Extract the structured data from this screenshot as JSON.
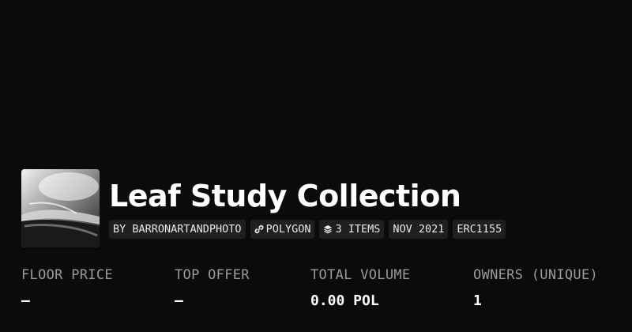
{
  "collection": {
    "title": "Leaf Study Collection",
    "thumbnail_icon": "leaf-photo-thumbnail"
  },
  "tags": {
    "creator": "BY BARRONARTANDPHOTO",
    "chain": "POLYGON",
    "chain_icon": "link-icon",
    "items": "3 ITEMS",
    "items_icon": "layers-icon",
    "date": "NOV 2021",
    "standard": "ERC1155"
  },
  "stats": [
    {
      "label": "FLOOR PRICE",
      "value": "—"
    },
    {
      "label": "TOP OFFER",
      "value": "—"
    },
    {
      "label": "TOTAL VOLUME",
      "value": "0.00 POL"
    },
    {
      "label": "OWNERS (UNIQUE)",
      "value": "1"
    }
  ],
  "colors": {
    "background": "#0b0b0b",
    "tag_background": "#1f1f1f",
    "label_text": "#9a9a9a",
    "value_text": "#ffffff"
  }
}
